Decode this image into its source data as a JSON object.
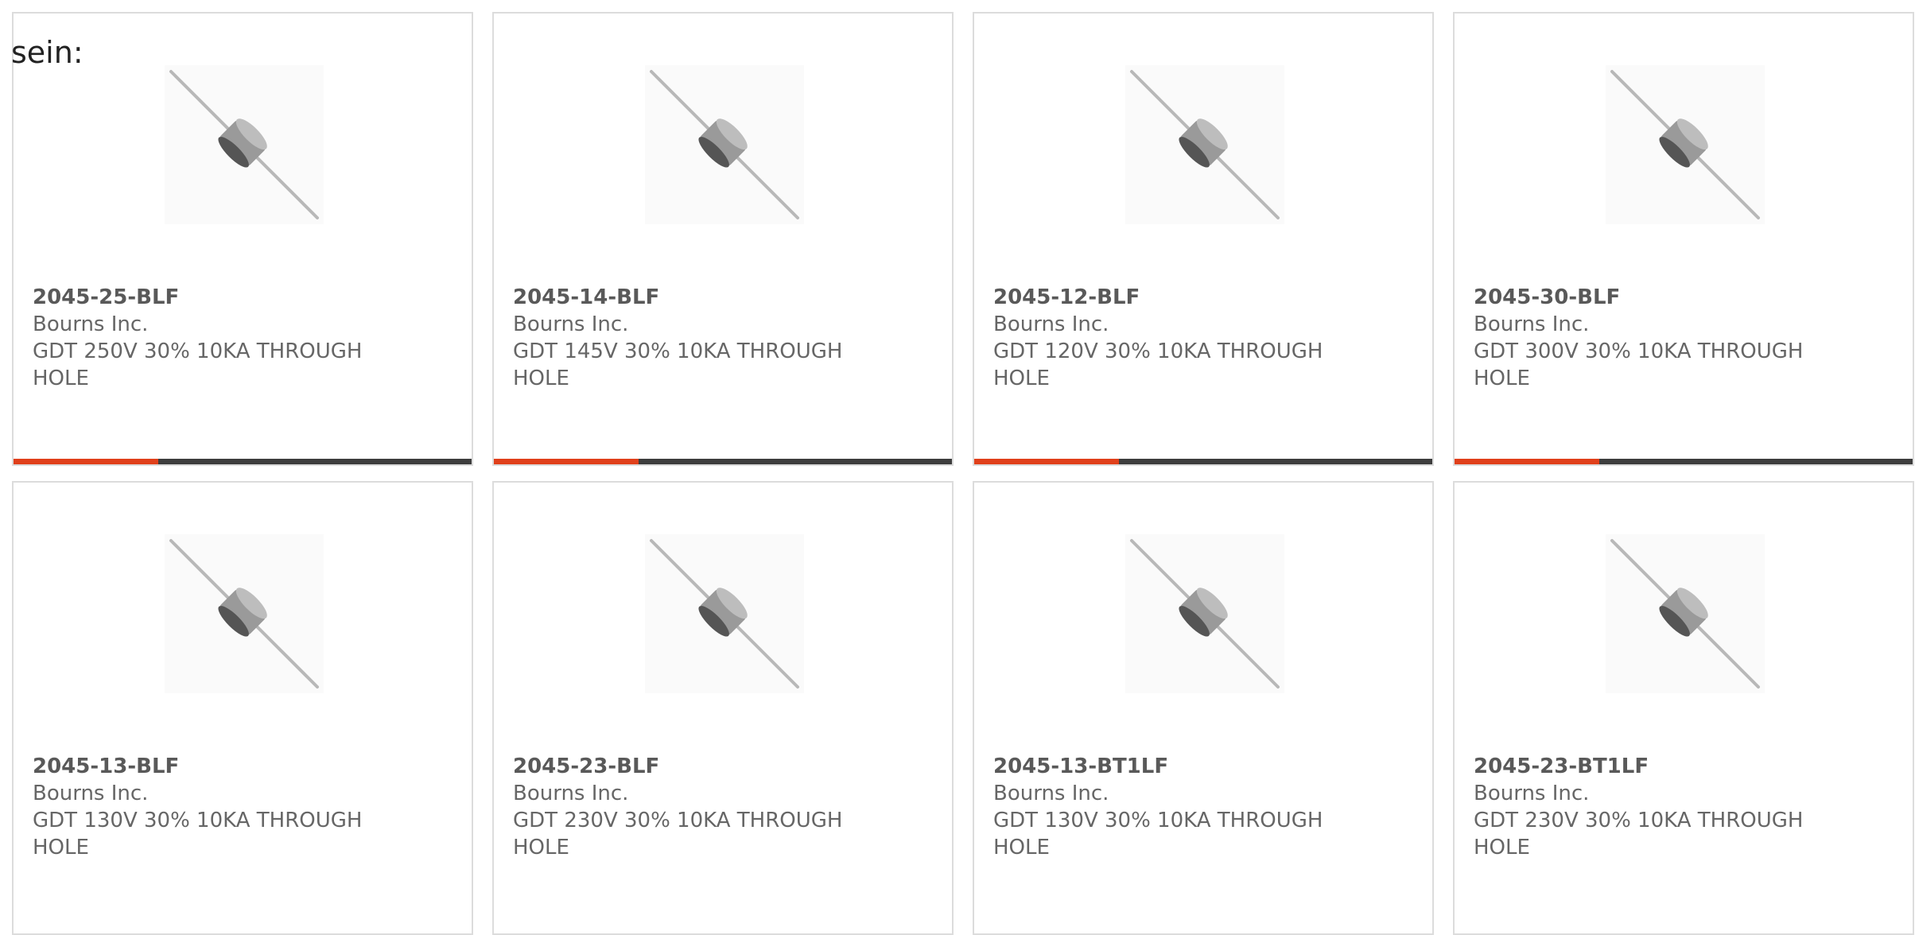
{
  "intro_text": "sein:",
  "colors": {
    "accent": "#e0401b",
    "bar": "#3d3d3d"
  },
  "product_image": "gas-discharge-tube-component-icon",
  "products": [
    {
      "part_number": "2045-25-BLF",
      "manufacturer": "Bourns Inc.",
      "description": "GDT 250V 30% 10KA THROUGH HOLE"
    },
    {
      "part_number": "2045-14-BLF",
      "manufacturer": "Bourns Inc.",
      "description": "GDT 145V 30% 10KA THROUGH HOLE"
    },
    {
      "part_number": "2045-12-BLF",
      "manufacturer": "Bourns Inc.",
      "description": "GDT 120V 30% 10KA THROUGH HOLE"
    },
    {
      "part_number": "2045-30-BLF",
      "manufacturer": "Bourns Inc.",
      "description": "GDT 300V 30% 10KA THROUGH HOLE"
    },
    {
      "part_number": "2045-13-BLF",
      "manufacturer": "Bourns Inc.",
      "description": "GDT 130V 30% 10KA THROUGH HOLE"
    },
    {
      "part_number": "2045-23-BLF",
      "manufacturer": "Bourns Inc.",
      "description": "GDT 230V 30% 10KA THROUGH HOLE"
    },
    {
      "part_number": "2045-13-BT1LF",
      "manufacturer": "Bourns Inc.",
      "description": "GDT 130V 30% 10KA THROUGH HOLE"
    },
    {
      "part_number": "2045-23-BT1LF",
      "manufacturer": "Bourns Inc.",
      "description": "GDT 230V 30% 10KA THROUGH HOLE"
    }
  ]
}
